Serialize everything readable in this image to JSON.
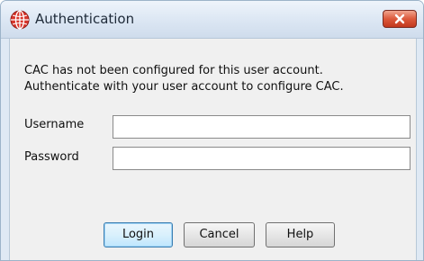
{
  "window": {
    "title": "Authentication",
    "title_icon": "globe-icon",
    "close_icon": "close-icon"
  },
  "message": {
    "line1": "CAC has not been configured for this user account.",
    "line2": "Authenticate with your user account to configure CAC."
  },
  "form": {
    "username_label": "Username",
    "username_value": "",
    "password_label": "Password",
    "password_value": ""
  },
  "buttons": {
    "login": "Login",
    "cancel": "Cancel",
    "help": "Help"
  },
  "colors": {
    "close_button": "#dc5a3c",
    "title_icon": "#d8362c",
    "default_button_border": "#3c7fb1"
  }
}
